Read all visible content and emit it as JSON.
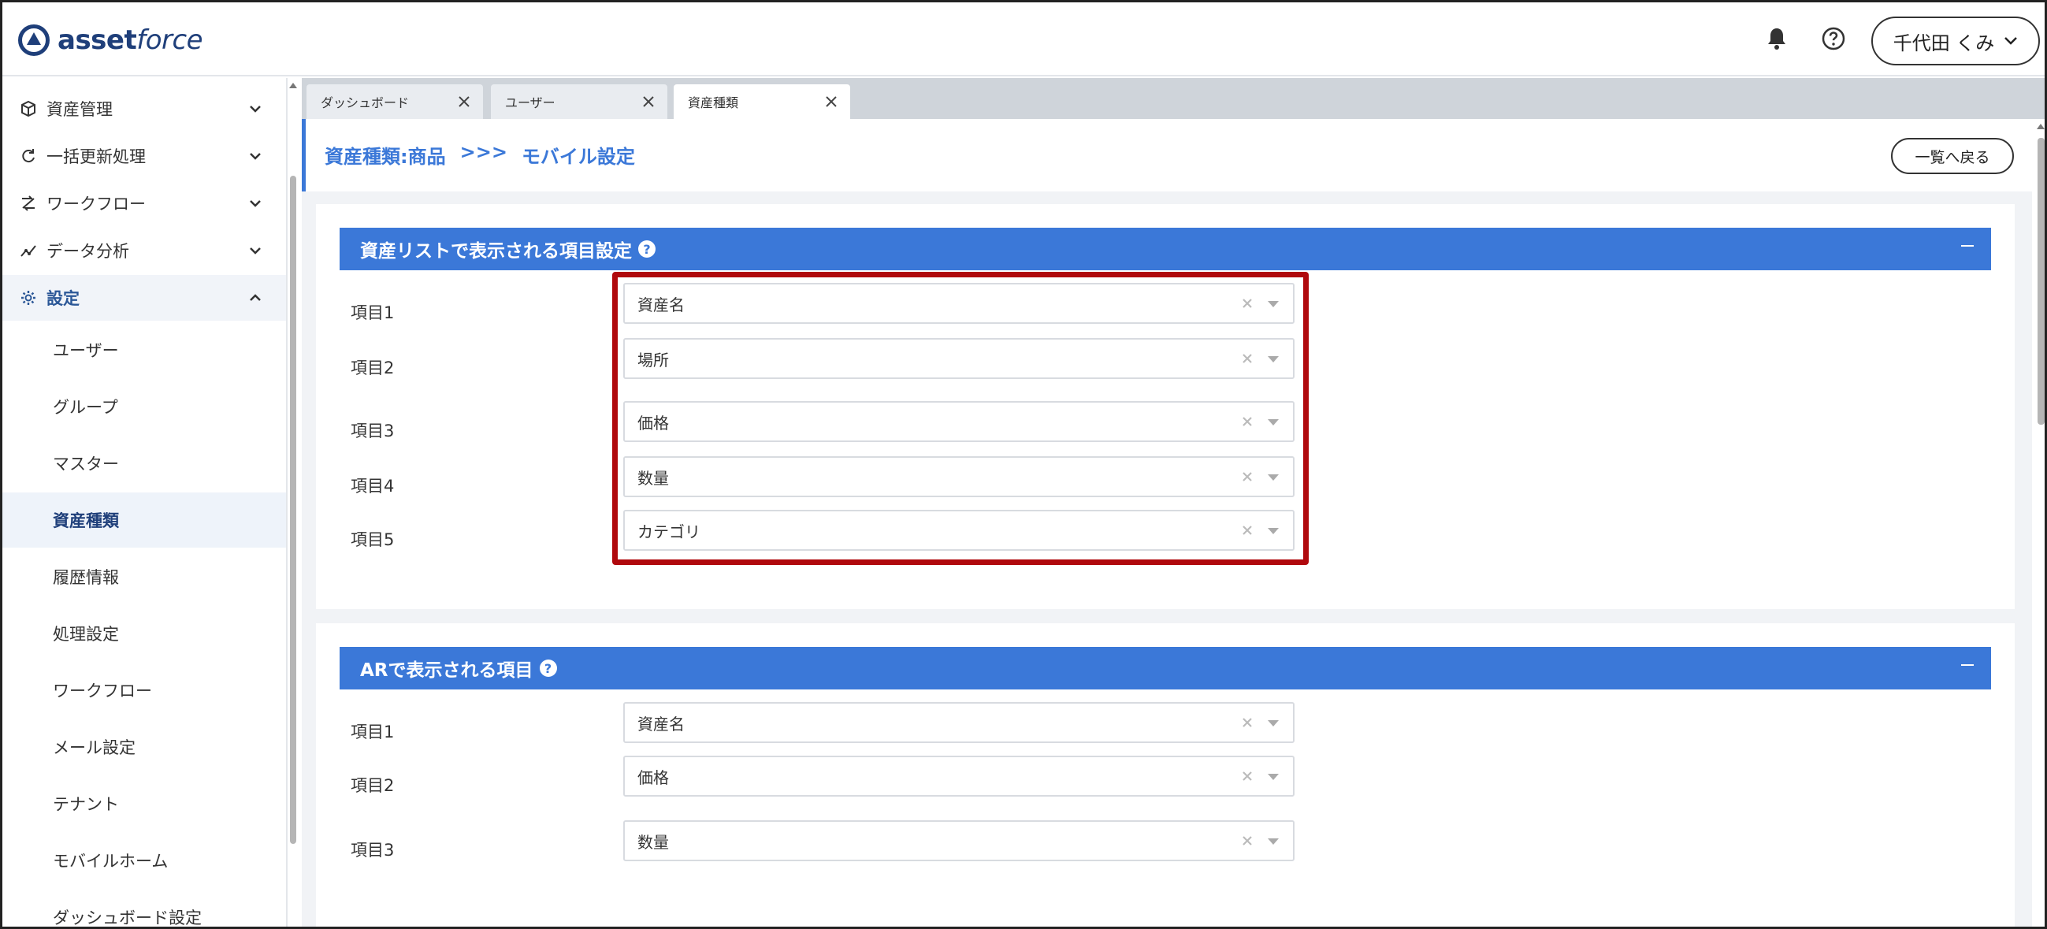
{
  "app": {
    "logo_bold": "asset",
    "logo_light": "force"
  },
  "header": {
    "user_name": "千代田 くみ"
  },
  "sidebar": {
    "items": [
      {
        "label": "資産管理"
      },
      {
        "label": "一括更新処理"
      },
      {
        "label": "ワークフロー"
      },
      {
        "label": "データ分析"
      },
      {
        "label": "設定"
      }
    ],
    "sub_items": [
      {
        "label": "ユーザー"
      },
      {
        "label": "グループ"
      },
      {
        "label": "マスター"
      },
      {
        "label": "資産種類"
      },
      {
        "label": "履歴情報"
      },
      {
        "label": "処理設定"
      },
      {
        "label": "ワークフロー"
      },
      {
        "label": "メール設定"
      },
      {
        "label": "テナント"
      },
      {
        "label": "モバイルホーム"
      },
      {
        "label": "ダッシュボード設定"
      }
    ]
  },
  "tabs": [
    {
      "label": "ダッシュボード"
    },
    {
      "label": "ユーザー"
    },
    {
      "label": "資産種類"
    }
  ],
  "page": {
    "breadcrumb_parent": "資産種類:商品",
    "breadcrumb_sep": ">>>",
    "breadcrumb_current": "モバイル設定",
    "back_button": "一覧へ戻る"
  },
  "list_section": {
    "title": "資産リストで表示される項目設定",
    "help": "?",
    "rows": [
      {
        "label": "項目1",
        "value": "資産名"
      },
      {
        "label": "項目2",
        "value": "場所"
      },
      {
        "label": "項目3",
        "value": "価格"
      },
      {
        "label": "項目4",
        "value": "数量"
      },
      {
        "label": "項目5",
        "value": "カテゴリ"
      }
    ]
  },
  "ar_section": {
    "title": "ARで表示される項目",
    "help": "?",
    "rows": [
      {
        "label": "項目1",
        "value": "資産名"
      },
      {
        "label": "項目2",
        "value": "価格"
      },
      {
        "label": "項目3",
        "value": "数量"
      }
    ]
  },
  "colors": {
    "accent": "#3b78d8",
    "brand": "#1f3f7a",
    "highlight": "#b0090d"
  }
}
